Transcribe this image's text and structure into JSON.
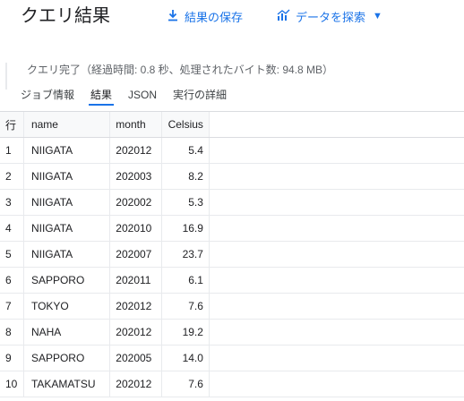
{
  "header": {
    "title": "クエリ結果",
    "save_label": "結果の保存",
    "explore_label": "データを探索"
  },
  "status": "クエリ完了（経過時間: 0.8 秒、処理されたバイト数: 94.8 MB）",
  "tabs": [
    {
      "label": "ジョブ情報",
      "active": false
    },
    {
      "label": "結果",
      "active": true
    },
    {
      "label": "JSON",
      "active": false
    },
    {
      "label": "実行の詳細",
      "active": false
    }
  ],
  "table": {
    "columns": [
      "行",
      "name",
      "month",
      "Celsius"
    ],
    "rows": [
      {
        "row": "1",
        "name": "NIIGATA",
        "month": "202012",
        "celsius": "5.4"
      },
      {
        "row": "2",
        "name": "NIIGATA",
        "month": "202003",
        "celsius": "8.2"
      },
      {
        "row": "3",
        "name": "NIIGATA",
        "month": "202002",
        "celsius": "5.3"
      },
      {
        "row": "4",
        "name": "NIIGATA",
        "month": "202010",
        "celsius": "16.9"
      },
      {
        "row": "5",
        "name": "NIIGATA",
        "month": "202007",
        "celsius": "23.7"
      },
      {
        "row": "6",
        "name": "SAPPORO",
        "month": "202011",
        "celsius": "6.1"
      },
      {
        "row": "7",
        "name": "TOKYO",
        "month": "202012",
        "celsius": "7.6"
      },
      {
        "row": "8",
        "name": "NAHA",
        "month": "202012",
        "celsius": "19.2"
      },
      {
        "row": "9",
        "name": "SAPPORO",
        "month": "202005",
        "celsius": "14.0"
      },
      {
        "row": "10",
        "name": "TAKAMATSU",
        "month": "202012",
        "celsius": "7.6"
      }
    ]
  },
  "colors": {
    "accent": "#1a73e8",
    "text": "#202124",
    "muted": "#5f6368"
  }
}
